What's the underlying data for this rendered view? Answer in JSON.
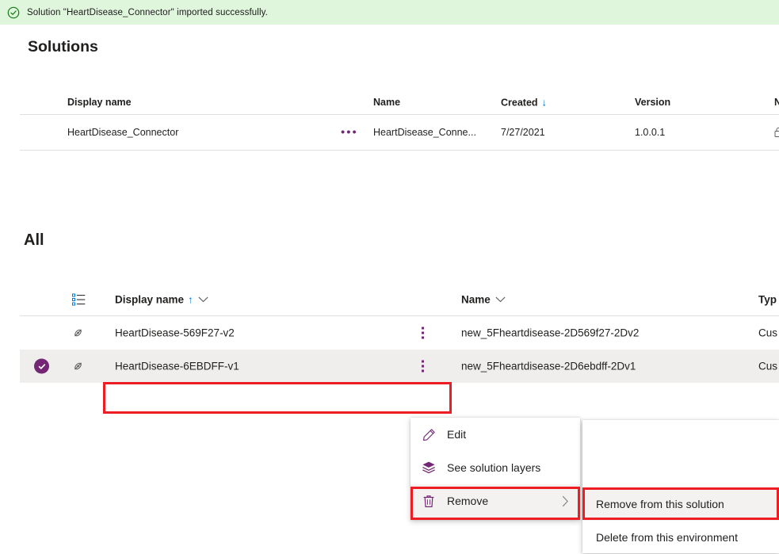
{
  "banner": {
    "icon": "check-circle-icon",
    "message": "Solution \"HeartDisease_Connector\" imported successfully.",
    "background": "#dff6dd"
  },
  "solutions_section": {
    "title": "Solutions",
    "columns": {
      "display_name": "Display name",
      "name": "Name",
      "created": "Created",
      "created_sort": "↓",
      "version": "Version",
      "partial": "N"
    },
    "rows": [
      {
        "display_name": "HeartDisease_Connector",
        "overflow": "…",
        "name": "HeartDisease_Conne...",
        "created": "7/27/2021",
        "version": "1.0.0.1"
      }
    ]
  },
  "all_section": {
    "title": "All",
    "columns": {
      "list_icon": "list-view-icon",
      "display_name": "Display name",
      "display_sort": "↑",
      "display_chevron": "chevron-down-icon",
      "name": "Name",
      "name_chevron": "chevron-down-icon",
      "type": "Typ"
    },
    "rows": [
      {
        "selected": false,
        "type_icon": "connector-icon",
        "display_name": "HeartDisease-569F27-v2",
        "kebab": "more-options-icon",
        "name": "new_5Fheartdisease-2D569f27-2Dv2",
        "type": "Cus"
      },
      {
        "selected": true,
        "type_icon": "connector-icon",
        "display_name": "HeartDisease-6EBDFF-v1",
        "kebab": "more-options-icon",
        "name": "new_5Fheartdisease-2D6ebdff-2Dv1",
        "type": "Cus"
      }
    ]
  },
  "context_menu": {
    "items": [
      {
        "label": "Edit",
        "icon": "pencil-icon",
        "has_submenu": false
      },
      {
        "label": "See solution layers",
        "icon": "layers-icon",
        "has_submenu": false
      },
      {
        "label": "Remove",
        "icon": "trash-icon",
        "has_submenu": true,
        "chevron": "chevron-right-icon",
        "highlighted": true
      }
    ]
  },
  "submenu": {
    "items": [
      {
        "label": "Remove from this solution",
        "highlighted": true
      },
      {
        "label": "Delete from this environment",
        "highlighted": false
      }
    ]
  },
  "colors": {
    "accent_purple": "#742774",
    "highlight_red": "#ee1d24",
    "banner_green": "#dff6dd",
    "row_selected": "#efeeed",
    "link_blue": "#0078d4"
  }
}
